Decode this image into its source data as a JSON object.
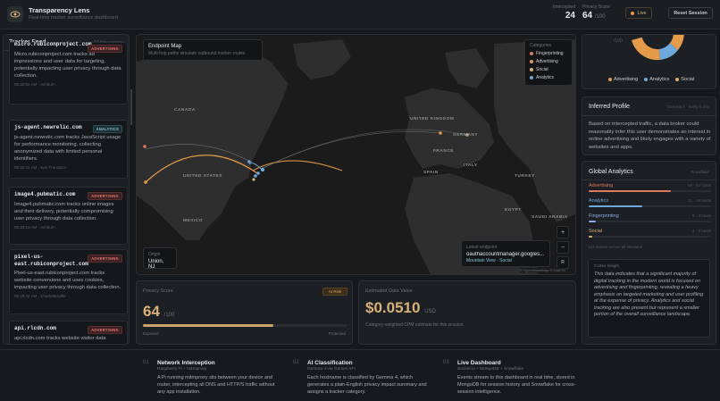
{
  "header": {
    "title": "Transparency Lens",
    "subtitle": "Real-time tracker surveillance dashboard",
    "intercepted_label": "Intercepted",
    "intercepted_value": "24",
    "privacy_label": "Privacy Score",
    "privacy_value": "64",
    "privacy_max": "/100",
    "live_label": "Live",
    "reset_label": "Reset Session"
  },
  "feed": {
    "title": "Tracker Feed",
    "count": "24 this session",
    "items": [
      {
        "host": "micro.rubiconproject.com",
        "badge": "ADVERTISING",
        "desc": "Micro.rubiconproject.com tracks ad impressions and user data for targeting, potentially impacting user privacy through data collection.",
        "time": "05:32:54 AM · Ashburn"
      },
      {
        "host": "js-agent.newrelic.com",
        "badge": "ANALYTICS",
        "desc": "js-agent.newrelic.com tracks JavaScript usage for performance monitoring, collecting anonymized data with limited personal identifiers.",
        "time": "05:32:41 AM · San Francisco"
      },
      {
        "host": "image4.pubmatic.com",
        "badge": "ADVERTISING",
        "desc": "Image4.pubmatic.com tracks online images and their delivery, potentially compromising user privacy through data collection.",
        "time": "05:30:10 AM · Ashburn"
      },
      {
        "host": "pixel-us-east.rubiconproject.com",
        "badge": "ADVERTISING",
        "desc": "Pixel-us-east.rubiconproject.com tracks website conversions and uses cookies, impacting user privacy through data collection.",
        "time": "05:29:44 AM · Charlottesville"
      },
      {
        "host": "api.rlcdn.com",
        "badge": "ADVERTISING",
        "desc": "api.rlcdn.com tracks website visitor data",
        "time": ""
      }
    ]
  },
  "map": {
    "title": "Endpoint Map",
    "subtitle": "Multi-hop paths simulate outbound tracker routes",
    "categories_title": "Categories",
    "categories": [
      {
        "name": "Fingerprinting",
        "color": "#e07a5f"
      },
      {
        "name": "Advertising",
        "color": "#e39b4a"
      },
      {
        "name": "Social",
        "color": "#d9b27a"
      },
      {
        "name": "Analytics",
        "color": "#6fa8dc"
      }
    ],
    "countries": [
      "CANADA",
      "UNITED STATES",
      "MEXICO",
      "UNITED KINGDOM",
      "GERMANY",
      "FRANCE",
      "SPAIN",
      "ITALY",
      "TURKEY",
      "EGYPT",
      "SAUDI ARABIA"
    ],
    "origin_label": "Origin",
    "origin_value": "Union, NJ",
    "latest_label": "Latest endpoint",
    "latest_host": "oauthaccountmanager.googles...",
    "latest_meta": "Mountain View · Social",
    "zoom_in": "+",
    "zoom_out": "−",
    "reset": "R",
    "attribution": "© OpenStreetMap © CARTO"
  },
  "score": {
    "label": "Privacy Score",
    "value": "64",
    "max": "/100",
    "badge": "At Risk",
    "fill_pct": 64,
    "left_label": "Exposed",
    "right_label": "Protected"
  },
  "value": {
    "label": "Estimated Data Value",
    "amount": "$0.0510",
    "currency": "USD",
    "note": "Category-weighted CPM estimate for this session"
  },
  "donut": {
    "legend": [
      {
        "name": "Advertising",
        "color": "#e39b4a"
      },
      {
        "name": "Analytics",
        "color": "#6fa8dc"
      },
      {
        "name": "Social",
        "color": "#d9b27a"
      }
    ]
  },
  "profile": {
    "title": "Inferred Profile",
    "meta": "Gemma 4 · every 5 min",
    "text": "Based on intercepted traffic, a data broker could reasonably infer this user demonstrates an interest in online advertising and likely engages with a variety of websites and apps."
  },
  "analytics": {
    "title": "Global Analytics",
    "meta": "Snowflake",
    "rows": [
      {
        "name": "Advertising",
        "hits": "69 · 53 hosts",
        "pct": 0.67,
        "color": "#e07a5f"
      },
      {
        "name": "Analytics",
        "hits": "31 · 16 hosts",
        "pct": 0.44,
        "color": "#6fa8dc"
      },
      {
        "name": "Fingerprinting",
        "hits": "8 · 3 hosts",
        "pct": 0.06,
        "color": "#8ea8e8"
      },
      {
        "name": "Social",
        "hits": "4 · 3 hosts",
        "pct": 0.03,
        "color": "#d9b27a"
      }
    ],
    "total": "122 events across all sessions",
    "insight_label": "Cortex Insight",
    "insight": "This data indicates that a significant majority of digital tracking in the modern world is focused on advertising and fingerprinting, revealing a heavy emphasis on targeted marketing and user profiling at the expense of privacy. Analytics and social tracking are also present but represent a smaller portion of the overall surveillance landscape."
  },
  "footer": [
    {
      "num": "01",
      "title": "Network Interception",
      "sub": "Raspberry Pi + mitmproxy",
      "desc": "A Pi running mitmproxy sits between your device and router, intercepting all DNS and HTTP/S traffic without any app installation."
    },
    {
      "num": "02",
      "title": "AI Classification",
      "sub": "Gemma 4 via Gemini API",
      "desc": "Each hostname is classified by Gemma 4, which generates a plain-English privacy impact summary and assigns a tracker category."
    },
    {
      "num": "03",
      "title": "Live Dashboard",
      "sub": "Socket.io + MongoDB + Snowflake",
      "desc": "Events stream to this dashboard in real time, stored in MongoDB for session history and Snowflake for cross-session intelligence."
    }
  ]
}
